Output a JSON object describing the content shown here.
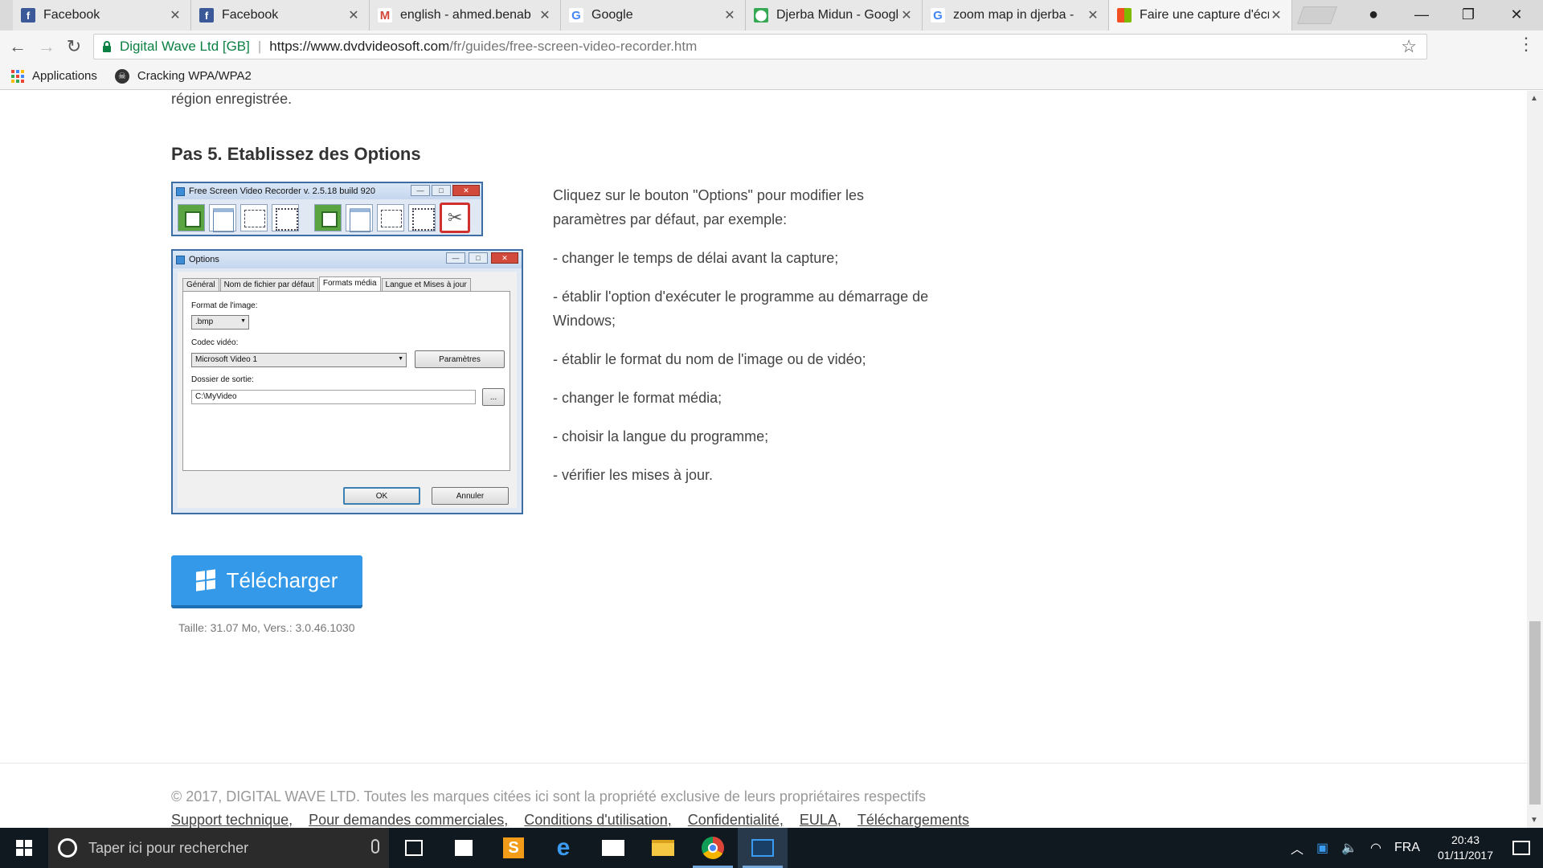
{
  "browser": {
    "tabs": [
      {
        "title": "Facebook",
        "icon": "facebook-icon"
      },
      {
        "title": "Facebook",
        "icon": "facebook-icon"
      },
      {
        "title": "english - ahmed.benab",
        "icon": "gmail-icon"
      },
      {
        "title": "Google",
        "icon": "google-icon"
      },
      {
        "title": "Djerba Midun - Google",
        "icon": "google-maps-icon"
      },
      {
        "title": "zoom map in djerba - ",
        "icon": "google-icon"
      },
      {
        "title": "Faire une capture d'écr",
        "icon": "windows-logo-icon"
      }
    ],
    "address": {
      "org": "Digital Wave Ltd [GB]",
      "scheme_host": "https://www.dvdvideosoft.com",
      "path": "/fr/guides/free-screen-video-recorder.htm"
    },
    "bookmarks": [
      {
        "label": "Applications",
        "icon": "apps-grid-icon"
      },
      {
        "label": "Cracking WPA/WPA2",
        "icon": "skull-icon"
      }
    ]
  },
  "page": {
    "prev_text": "région enregistrée.",
    "step_title": "Pas 5. Etablissez des Options",
    "tool_window_title": "Free Screen Video Recorder  v. 2.5.18 build 920",
    "options_window": {
      "title": "Options",
      "tabs": [
        "Général",
        "Nom de fichier par défaut",
        "Formats média",
        "Langue et Mises à jour"
      ],
      "image_format_label": "Format de l'image:",
      "image_format_value": ".bmp",
      "codec_label": "Codec vidéo:",
      "codec_value": "Microsoft Video 1",
      "params_button": "Paramètres",
      "output_label": "Dossier de sortie:",
      "output_value": "C:\\MyVideo",
      "browse_button": "...",
      "ok_button": "OK",
      "cancel_button": "Annuler"
    },
    "description": [
      "Cliquez sur le bouton \"Options\" pour modifier les paramètres par défaut, par exemple:",
      "- changer le temps de délai avant la capture;",
      "- établir l'option d'exécuter le programme au démarrage de Windows;",
      "- établir le format du nom de l'image ou de vidéo;",
      "- changer le format média;",
      "- choisir la langue du programme;",
      "- vérifier les mises à jour."
    ],
    "download_button": "Télécharger",
    "download_meta": "Taille: 31.07 Mo, Vers.: 3.0.46.1030",
    "copyright": "© 2017, DIGITAL WAVE LTD. Toutes les marques citées ici sont la propriété exclusive de leurs propriétaires respectifs",
    "footer_links": [
      "Support technique,",
      "Pour demandes commerciales,",
      "Conditions d'utilisation,",
      "Confidentialité,",
      "EULA,",
      "Téléchargements"
    ]
  },
  "taskbar": {
    "search_placeholder": "Taper ici pour rechercher",
    "language": "FRA",
    "time": "20:43",
    "date": "01/11/2017"
  },
  "colors": {
    "secure_green": "#0b8043",
    "download_blue": "#3399e8",
    "taskbar_bg": "#101820"
  }
}
